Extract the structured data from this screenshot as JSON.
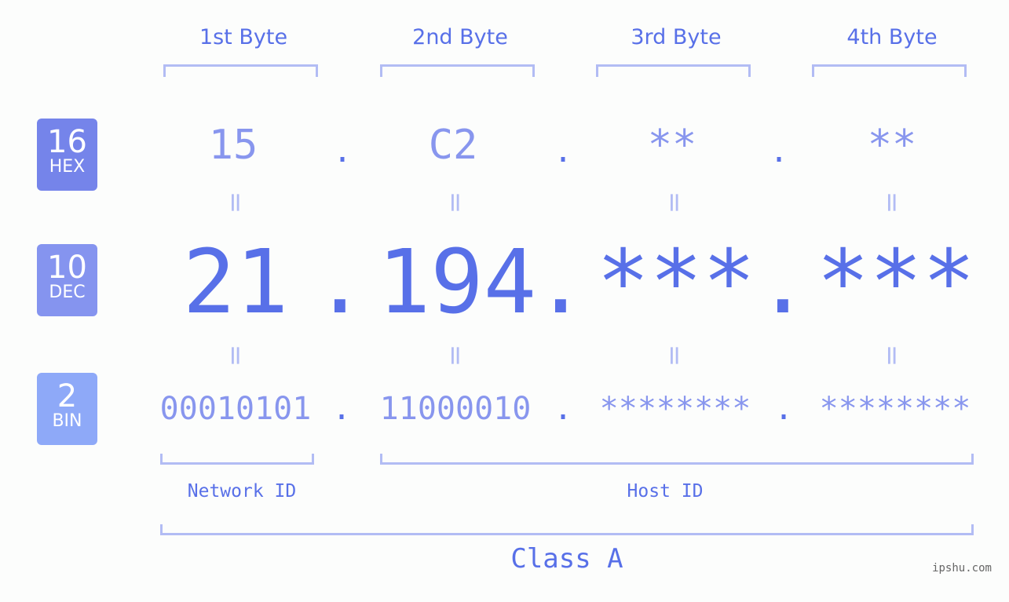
{
  "bytes": [
    "1st Byte",
    "2nd Byte",
    "3rd Byte",
    "4th Byte"
  ],
  "badges": {
    "hex": {
      "num": "16",
      "label": "HEX",
      "color": "#7584ea"
    },
    "dec": {
      "num": "10",
      "label": "DEC",
      "color": "#8594ef"
    },
    "bin": {
      "num": "2",
      "label": "BIN",
      "color": "#8ea9f8"
    }
  },
  "hex": [
    "15",
    "C2",
    "**",
    "**"
  ],
  "dec": [
    "21",
    "194",
    "***",
    "***"
  ],
  "bin": [
    "00010101",
    "11000010",
    "********",
    "********"
  ],
  "separator": ".",
  "equals": "=",
  "network_label": "Network ID",
  "host_label": "Host ID",
  "class_label": "Class A",
  "watermark": "ipshu.com"
}
